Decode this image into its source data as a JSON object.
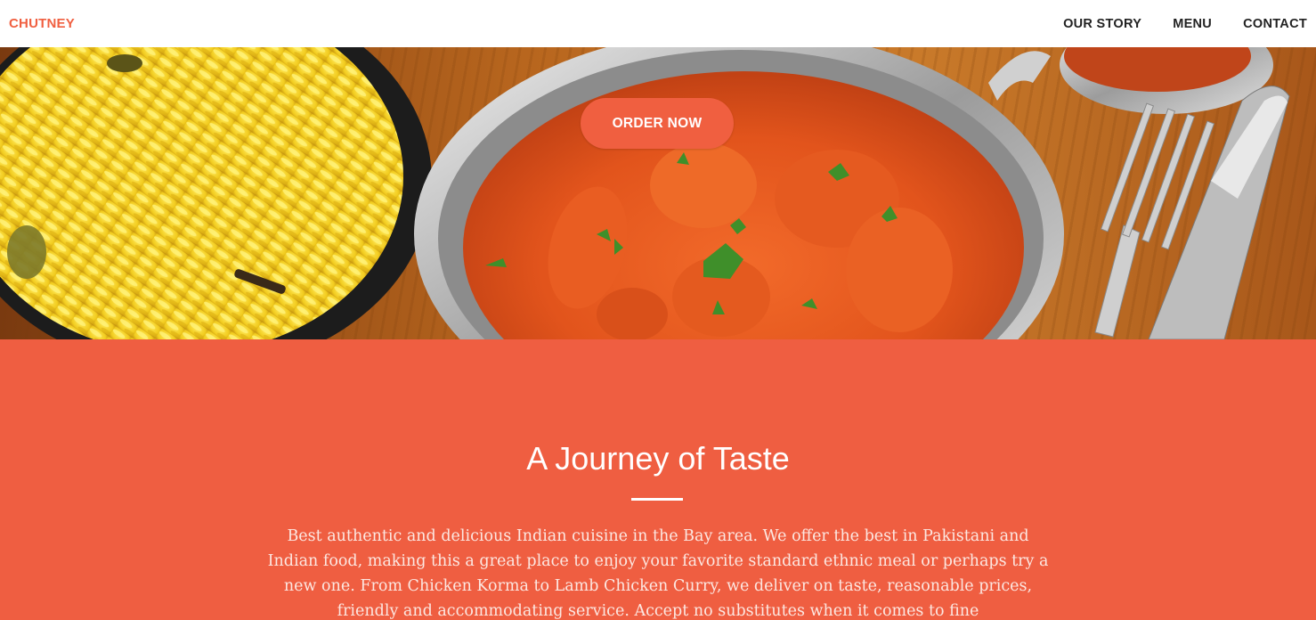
{
  "nav": {
    "brand": "CHUTNEY",
    "links": [
      {
        "label": "OUR STORY"
      },
      {
        "label": "MENU"
      },
      {
        "label": "CONTACT"
      }
    ]
  },
  "hero": {
    "image_icon": "curry-dishes-photo",
    "cta_label": "ORDER NOW"
  },
  "about": {
    "title": "A Journey of Taste",
    "body": "Best authentic and delicious Indian cuisine in the Bay area. We offer the best in Pakistani and Indian food, making this a great place to enjoy your favorite standard ethnic meal or perhaps try a new one. From Chicken Korma to Lamb Chicken Curry, we deliver on taste, reasonable prices, friendly and accommodating service. Accept no substitutes when it comes to fine"
  },
  "colors": {
    "accent": "#f05f40",
    "section_bg": "#ef5e41",
    "nav_text": "#222222"
  }
}
